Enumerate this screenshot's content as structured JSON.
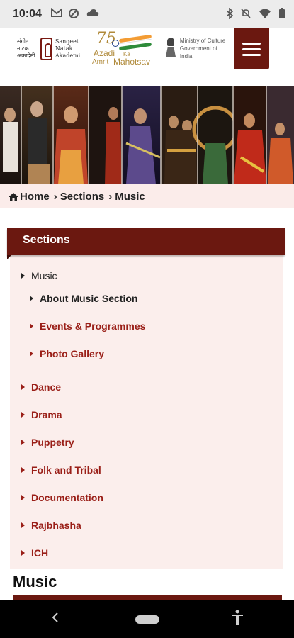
{
  "status_bar": {
    "time": "10:04",
    "left_icons": [
      "gmail-icon",
      "sync-icon",
      "cloud-icon"
    ],
    "right_icons": [
      "bluetooth-icon",
      "mute-icon",
      "wifi-icon",
      "battery-icon"
    ]
  },
  "header": {
    "sna_logo": {
      "hindi_lines": [
        "संगीत",
        "नाटक",
        "अकादेमी"
      ],
      "english_lines": [
        "Sangeet",
        "Natak",
        "Akademi"
      ]
    },
    "azadi_logo": {
      "number": "75",
      "line1": "Azadi",
      "ka": "Ka",
      "line2a": "Amrit",
      "line2b": "Mahotsav"
    },
    "ministry_logo": {
      "line1": "Ministry of Culture",
      "line2": "Government of India"
    },
    "menu_icon": "hamburger-icon"
  },
  "breadcrumb": {
    "home_icon": "home-icon",
    "items": [
      "Home",
      "Sections",
      "Music"
    ]
  },
  "sections_panel": {
    "title": "Sections",
    "items": [
      {
        "label": "Music"
      },
      {
        "label": "About Music Section"
      },
      {
        "label": "Events & Programmes"
      },
      {
        "label": "Photo Gallery"
      },
      {
        "label": "Dance"
      },
      {
        "label": "Drama"
      },
      {
        "label": "Puppetry"
      },
      {
        "label": "Folk and Tribal"
      },
      {
        "label": "Documentation"
      },
      {
        "label": "Rajbhasha"
      },
      {
        "label": "ICH"
      }
    ]
  },
  "page_heading": "Music",
  "colors": {
    "brand": "#6b1810",
    "link_red": "#9a1f18",
    "panel_bg": "#fbeeec",
    "breadcrumb_bg": "#fbecea"
  },
  "nav_bar": {
    "back_icon": "back-icon",
    "home_icon": "home-pill-icon",
    "accessibility_icon": "accessibility-icon"
  }
}
